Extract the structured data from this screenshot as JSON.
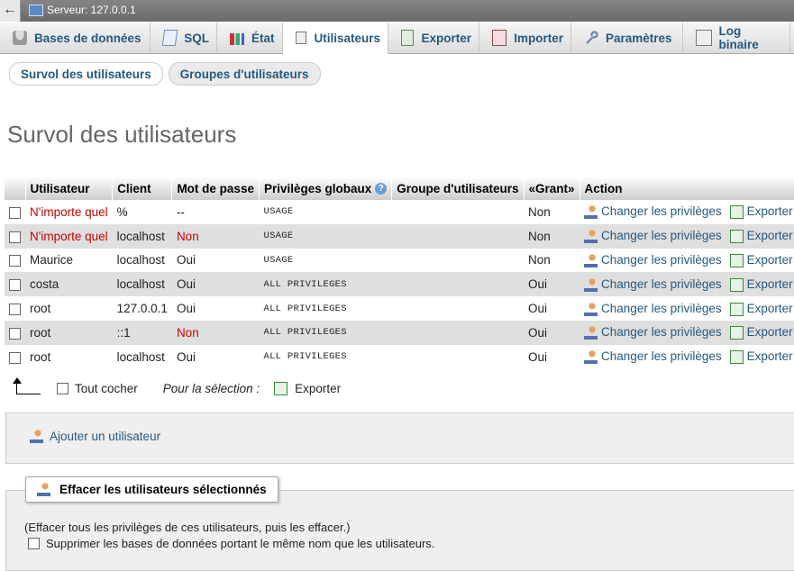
{
  "top_bar": {
    "back": "←",
    "server": "Serveur: 127.0.0.1"
  },
  "tabs": [
    {
      "label": "Bases de données",
      "icon": "database-icon"
    },
    {
      "label": "SQL",
      "icon": "sql-icon"
    },
    {
      "label": "État",
      "icon": "status-icon"
    },
    {
      "label": "Utilisateurs",
      "icon": "users-icon",
      "active": true
    },
    {
      "label": "Exporter",
      "icon": "export-icon"
    },
    {
      "label": "Importer",
      "icon": "import-icon"
    },
    {
      "label": "Paramètres",
      "icon": "wrench-icon"
    },
    {
      "label": "Log binaire",
      "icon": "binary-log-icon"
    }
  ],
  "subtabs": [
    "Survol des utilisateurs",
    "Groupes d'utilisateurs"
  ],
  "page_title": "Survol des utilisateurs",
  "table": {
    "headers": [
      "Utilisateur",
      "Client",
      "Mot de passe",
      "Privilèges globaux",
      "Groupe d'utilisateurs",
      "«Grant»",
      "Action"
    ],
    "rows": [
      {
        "user": "N'importe quel",
        "user_red": true,
        "host": "%",
        "password": "--",
        "password_red": false,
        "privileges": "USAGE",
        "group": "",
        "grant": "Non"
      },
      {
        "user": "N'importe quel",
        "user_red": true,
        "host": "localhost",
        "password": "Non",
        "password_red": true,
        "privileges": "USAGE",
        "group": "",
        "grant": "Non"
      },
      {
        "user": "Maurice",
        "user_red": false,
        "host": "localhost",
        "password": "Oui",
        "password_red": false,
        "privileges": "USAGE",
        "group": "",
        "grant": "Non"
      },
      {
        "user": "costa",
        "user_red": false,
        "host": "localhost",
        "password": "Oui",
        "password_red": false,
        "privileges": "ALL PRIVILEGES",
        "group": "",
        "grant": "Oui"
      },
      {
        "user": "root",
        "user_red": false,
        "host": "127.0.0.1",
        "password": "Oui",
        "password_red": false,
        "privileges": "ALL PRIVILEGES",
        "group": "",
        "grant": "Oui"
      },
      {
        "user": "root",
        "user_red": false,
        "host": "::1",
        "password": "Non",
        "password_red": true,
        "privileges": "ALL PRIVILEGES",
        "group": "",
        "grant": "Oui"
      },
      {
        "user": "root",
        "user_red": false,
        "host": "localhost",
        "password": "Oui",
        "password_red": false,
        "privileges": "ALL PRIVILEGES",
        "group": "",
        "grant": "Oui"
      }
    ],
    "action_edit": "Changer les privilèges",
    "action_export": "Exporter"
  },
  "selection": {
    "check_all": "Tout cocher",
    "with_selected": "Pour la sélection :",
    "export": "Exporter"
  },
  "add_user": "Ajouter un utilisateur",
  "delete_section": {
    "legend": "Effacer les utilisateurs sélectionnés",
    "note": "(Effacer tous les privilèges de ces utilisateurs, puis les effacer.)",
    "drop_db_label": "Supprimer les bases de données portant le même nom que les utilisateurs."
  },
  "colors": {
    "link": "#235a81",
    "red": "#cc0000",
    "title": "#666666"
  }
}
